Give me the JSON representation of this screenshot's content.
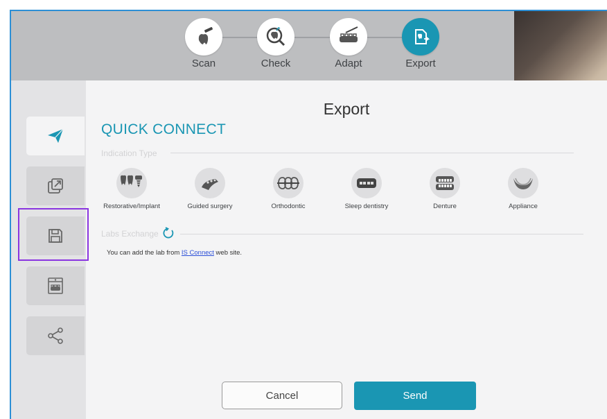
{
  "steps": [
    {
      "label": "Scan",
      "icon": "scan-tooth-icon",
      "active": false
    },
    {
      "label": "Check",
      "icon": "check-tooth-icon",
      "active": false
    },
    {
      "label": "Adapt",
      "icon": "adapt-arch-icon",
      "active": false
    },
    {
      "label": "Export",
      "icon": "export-tooth-icon",
      "active": true
    }
  ],
  "sidebar": {
    "items": [
      {
        "icon": "send-icon",
        "active": true
      },
      {
        "icon": "open-external-icon",
        "active": false
      },
      {
        "icon": "save-icon",
        "active": false,
        "highlighted": true
      },
      {
        "icon": "print-model-icon",
        "active": false
      },
      {
        "icon": "share-icon",
        "active": false
      }
    ]
  },
  "main": {
    "title": "Export",
    "quick_connect": "QUICK CONNECT",
    "indication_type_label": "Indication Type",
    "indications": [
      {
        "label": "Restorative/Implant",
        "icon": "implant-icon"
      },
      {
        "label": "Guided surgery",
        "icon": "guided-surgery-icon"
      },
      {
        "label": "Orthodontic",
        "icon": "orthodontic-icon"
      },
      {
        "label": "Sleep dentistry",
        "icon": "sleep-dentistry-icon"
      },
      {
        "label": "Denture",
        "icon": "denture-icon"
      },
      {
        "label": "Appliance",
        "icon": "appliance-icon"
      }
    ],
    "labs_exchange_label": "Labs Exchange",
    "info_prefix": "You can add the lab from ",
    "info_link": "IS Connect",
    "info_suffix": " web site."
  },
  "buttons": {
    "cancel": "Cancel",
    "send": "Send"
  },
  "colors": {
    "accent": "#1a96b3",
    "highlight": "#8a35e0",
    "topbar": "#bdbec0"
  }
}
